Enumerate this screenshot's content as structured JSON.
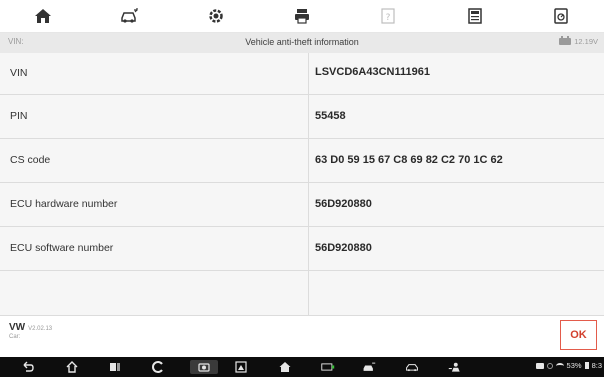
{
  "toolbar": {
    "buttons": [
      {
        "icon": "home-icon"
      },
      {
        "icon": "vehicle-swap-icon"
      },
      {
        "icon": "settings-gear-icon"
      },
      {
        "icon": "print-icon"
      },
      {
        "icon": "help-icon"
      },
      {
        "icon": "save-file-icon"
      },
      {
        "icon": "data-logging-icon"
      }
    ]
  },
  "subheader": {
    "vin_label": "VIN:",
    "title": "Vehicle anti-theft information",
    "voltage": "12.19V"
  },
  "table": {
    "rows": [
      {
        "label": "VIN",
        "value": "LSVCD6A43CN111961"
      },
      {
        "label": "PIN",
        "value": "55458"
      },
      {
        "label": "CS code",
        "value": "63 D0 59 15 67 C8 69 82 C2 70 1C 62"
      },
      {
        "label": "ECU hardware number",
        "value": "56D920880"
      },
      {
        "label": "ECU software number",
        "value": "56D920880"
      },
      {
        "label": "",
        "value": ""
      }
    ]
  },
  "footer": {
    "brand": "VW",
    "version": "V2.02.13",
    "car_label": "Car:",
    "ok_label": "OK"
  },
  "navbar": {
    "battery": "53%",
    "time": "8:3",
    "colors": {
      "background": "#0d0d0d",
      "icon": "#e6e6e6"
    }
  },
  "colors": {
    "accent": "#d2402e",
    "table_bg": "#f6f6f6",
    "header_bg": "#e9e9e9"
  }
}
